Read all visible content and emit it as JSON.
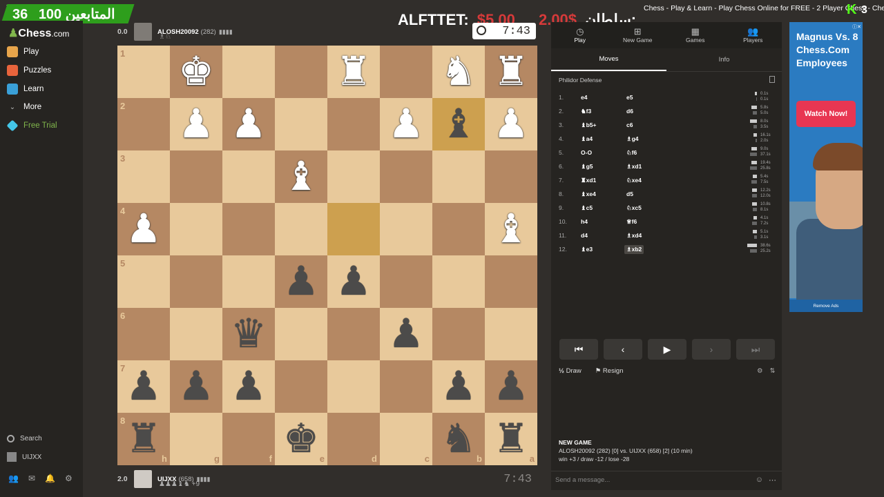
{
  "overlay": {
    "followers_count": "36",
    "followers_label": "المتابعين",
    "second_count": "100",
    "donation_name": "ALFTTET:",
    "donation_amount": "$5.00",
    "donation_amount_2": "2.00$",
    "donation_name_2": "سلطان:",
    "timer": "7:43",
    "window_title": "Chess - Play & Learn - Play Chess Online for FREE - 2 Player Chess - Chess.com",
    "kick_count": "3"
  },
  "sidebar": {
    "logo": "Chess",
    "logo_suffix": ".com",
    "items": [
      {
        "label": "Play",
        "color": "#e8a54b"
      },
      {
        "label": "Puzzles",
        "color": "#e8643c"
      },
      {
        "label": "Learn",
        "color": "#3aa0d8"
      },
      {
        "label": "More"
      },
      {
        "label": "Free Trial",
        "color": "#44c6e8"
      }
    ],
    "search_label": "Search",
    "username": "UIJXX"
  },
  "top_player": {
    "score": "0.0",
    "name": "ALOSH20092",
    "rating": "(282)",
    "captured": "♗♘"
  },
  "bottom_player": {
    "score": "2.0",
    "name": "UIJXX",
    "rating": "(658)",
    "captured": "♟♟♟♝♞",
    "material": "+9",
    "clock": "7:43"
  },
  "board": {
    "ranks": [
      "1",
      "2",
      "3",
      "4",
      "5",
      "6",
      "7",
      "8"
    ],
    "files": [
      "h",
      "g",
      "f",
      "e",
      "d",
      "c",
      "b",
      "a"
    ],
    "highlight": [
      [
        1,
        6
      ],
      [
        3,
        4
      ]
    ],
    "pieces": [
      {
        "r": 0,
        "c": 1,
        "p": "♚",
        "side": "w",
        "name": "white-king"
      },
      {
        "r": 0,
        "c": 4,
        "p": "♜",
        "side": "w",
        "name": "white-rook"
      },
      {
        "r": 0,
        "c": 6,
        "p": "♞",
        "side": "w",
        "name": "white-knight"
      },
      {
        "r": 0,
        "c": 7,
        "p": "♜",
        "side": "w",
        "name": "white-rook"
      },
      {
        "r": 1,
        "c": 1,
        "p": "♟",
        "side": "w",
        "name": "white-pawn"
      },
      {
        "r": 1,
        "c": 2,
        "p": "♟",
        "side": "w",
        "name": "white-pawn"
      },
      {
        "r": 1,
        "c": 5,
        "p": "♟",
        "side": "w",
        "name": "white-pawn"
      },
      {
        "r": 1,
        "c": 6,
        "p": "♝",
        "side": "b",
        "name": "black-bishop"
      },
      {
        "r": 1,
        "c": 7,
        "p": "♟",
        "side": "w",
        "name": "white-pawn"
      },
      {
        "r": 2,
        "c": 3,
        "p": "♝",
        "side": "w",
        "name": "white-bishop"
      },
      {
        "r": 3,
        "c": 0,
        "p": "♟",
        "side": "w",
        "name": "white-pawn"
      },
      {
        "r": 3,
        "c": 7,
        "p": "♝",
        "side": "w",
        "name": "white-bishop"
      },
      {
        "r": 4,
        "c": 3,
        "p": "♟",
        "side": "b",
        "name": "black-pawn"
      },
      {
        "r": 4,
        "c": 4,
        "p": "♟",
        "side": "b",
        "name": "black-pawn"
      },
      {
        "r": 5,
        "c": 2,
        "p": "♛",
        "side": "b",
        "name": "black-queen"
      },
      {
        "r": 5,
        "c": 5,
        "p": "♟",
        "side": "b",
        "name": "black-pawn"
      },
      {
        "r": 6,
        "c": 0,
        "p": "♟",
        "side": "b",
        "name": "black-pawn"
      },
      {
        "r": 6,
        "c": 1,
        "p": "♟",
        "side": "b",
        "name": "black-pawn"
      },
      {
        "r": 6,
        "c": 2,
        "p": "♟",
        "side": "b",
        "name": "black-pawn"
      },
      {
        "r": 6,
        "c": 6,
        "p": "♟",
        "side": "b",
        "name": "black-pawn"
      },
      {
        "r": 6,
        "c": 7,
        "p": "♟",
        "side": "b",
        "name": "black-pawn"
      },
      {
        "r": 7,
        "c": 0,
        "p": "♜",
        "side": "b",
        "name": "black-rook"
      },
      {
        "r": 7,
        "c": 3,
        "p": "♚",
        "side": "b",
        "name": "black-king"
      },
      {
        "r": 7,
        "c": 6,
        "p": "♞",
        "side": "b",
        "name": "black-knight"
      },
      {
        "r": 7,
        "c": 7,
        "p": "♜",
        "side": "b",
        "name": "black-rook"
      }
    ]
  },
  "panel": {
    "tabs": [
      {
        "label": "Play",
        "icon": "◷"
      },
      {
        "label": "New Game",
        "icon": "⊞"
      },
      {
        "label": "Games",
        "icon": "▦"
      },
      {
        "label": "Players",
        "icon": "👥"
      }
    ],
    "subtabs": [
      "Moves",
      "Info"
    ],
    "opening": "Philidor Defense",
    "moves": [
      {
        "n": "1.",
        "w": "e4",
        "b": "e5",
        "t1": "0.1s",
        "t2": "0.1s",
        "b1": 3,
        "b2": 1
      },
      {
        "n": "2.",
        "w": "♞f3",
        "b": "d6",
        "t1": "5.8s",
        "t2": "5.0s",
        "b1": 8,
        "b2": 6
      },
      {
        "n": "3.",
        "w": "♝b5+",
        "b": "c6",
        "t1": "8.0s",
        "t2": "3.5s",
        "b1": 10,
        "b2": 5
      },
      {
        "n": "4.",
        "w": "♝a4",
        "b": "♗g4",
        "t1": "16.1s",
        "t2": "2.0s",
        "b1": 5,
        "b2": 2
      },
      {
        "n": "5.",
        "w": "O-O",
        "b": "♘f6",
        "t1": "9.0s",
        "t2": "37.1s",
        "b1": 8,
        "b2": 10
      },
      {
        "n": "6.",
        "w": "♝g5",
        "b": "♗xd1",
        "t1": "19.4s",
        "t2": "25.8s",
        "b1": 8,
        "b2": 10
      },
      {
        "n": "7.",
        "w": "♜xd1",
        "b": "♘xe4",
        "t1": "5.4s",
        "t2": "7.5s",
        "b1": 6,
        "b2": 8
      },
      {
        "n": "8.",
        "w": "♝xe4",
        "b": "d5",
        "t1": "12.2s",
        "t2": "12.0s",
        "b1": 7,
        "b2": 7
      },
      {
        "n": "9.",
        "w": "♝c5",
        "b": "♘xc5",
        "t1": "10.8s",
        "t2": "8.1s",
        "b1": 7,
        "b2": 6
      },
      {
        "n": "10.",
        "w": "h4",
        "b": "♕f6",
        "t1": "4.1s",
        "t2": "7.2s",
        "b1": 5,
        "b2": 7
      },
      {
        "n": "11.",
        "w": "d4",
        "b": "♗xd4",
        "t1": "5.1s",
        "t2": "3.1s",
        "b1": 6,
        "b2": 4
      },
      {
        "n": "12.",
        "w": "♝e3",
        "b": "♗xb2",
        "t1": "38.6s",
        "t2": "25.2s",
        "b1": 14,
        "b2": 10
      }
    ],
    "draw_label": "Draw",
    "resign_label": "Resign",
    "game_header": "NEW GAME",
    "game_line": "ALOSH20092 (282) [0] vs. UIJXX (658) [2] (10 min)",
    "game_stats": "win +3 / draw -12 / lose -28",
    "chat_placeholder": "Send a message..."
  },
  "ad": {
    "headline": "Magnus Vs. 8 Chess.Com Employees",
    "button": "Watch Now!",
    "remove": "Remove Ads"
  }
}
